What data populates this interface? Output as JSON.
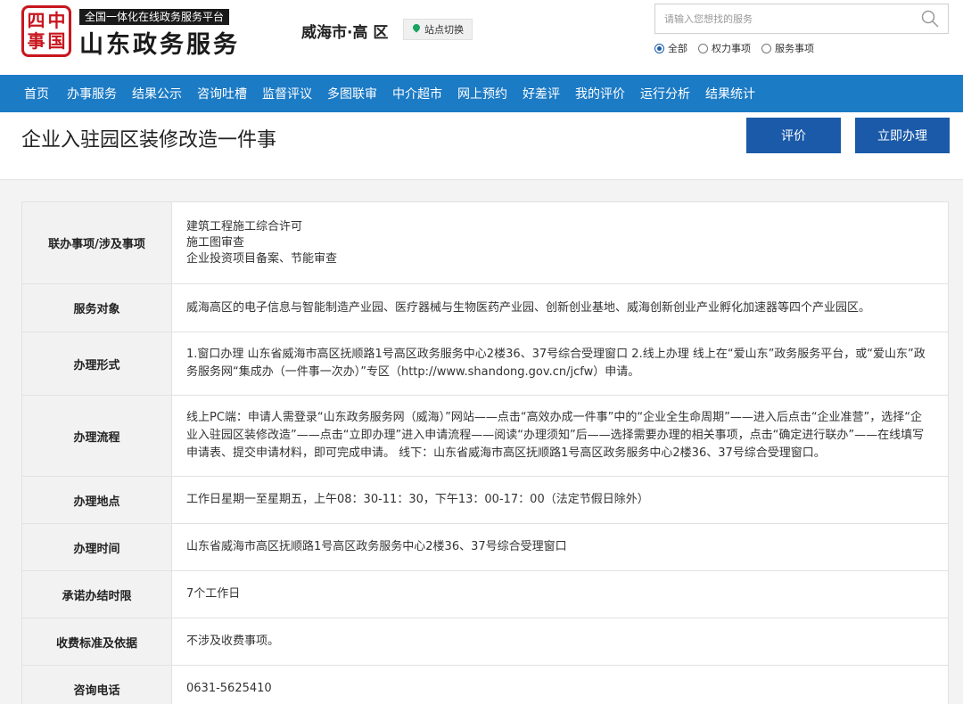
{
  "header": {
    "seal_chars": [
      "四",
      "中",
      "事",
      "国"
    ],
    "tagline": "全国一体化在线政务服务平台",
    "brand": "山东政务服务",
    "city": "威海市·高 区",
    "switch_label": "站点切换",
    "search_placeholder": "请输入您想找的服务",
    "filters": [
      {
        "label": "全部",
        "selected": true
      },
      {
        "label": "权力事项",
        "selected": false
      },
      {
        "label": "服务事项",
        "selected": false
      }
    ]
  },
  "nav": [
    "首页",
    "办事服务",
    "结果公示",
    "咨询吐槽",
    "监督评议",
    "多图联审",
    "中介超市",
    "网上预约",
    "好差评",
    "我的评价",
    "运行分析",
    "结果统计"
  ],
  "page": {
    "title": "企业入驻园区装修改造一件事",
    "rate_button": "评价",
    "apply_button": "立即办理"
  },
  "rows": [
    {
      "label": "联办事项/涉及事项",
      "lines": [
        "建筑工程施工综合许可",
        "施工图审查",
        "企业投资项目备案、节能审查"
      ]
    },
    {
      "label": "服务对象",
      "value": "威海高区的电子信息与智能制造产业园、医疗器械与生物医药产业园、创新创业基地、威海创新创业产业孵化加速器等四个产业园区。"
    },
    {
      "label": "办理形式",
      "value": "1.窗口办理 山东省威海市高区抚顺路1号高区政务服务中心2楼36、37号综合受理窗口 2.线上办理 线上在“爱山东”政务服务平台，或“爱山东”政务服务网“集成办（一件事一次办）”专区（http://www.shandong.gov.cn/jcfw）申请。"
    },
    {
      "label": "办理流程",
      "value": "线上PC端：申请人需登录“山东政务服务网（威海）”网站——点击“高效办成一件事”中的“企业全生命周期”——进入后点击“企业准营”，选择“企业入驻园区装修改造”——点击“立即办理”进入申请流程——阅读“办理须知”后——选择需要办理的相关事项，点击“确定进行联办”——在线填写申请表、提交申请材料，即可完成申请。 线下：山东省威海市高区抚顺路1号高区政务服务中心2楼36、37号综合受理窗口。"
    },
    {
      "label": "办理地点",
      "value": "工作日星期一至星期五，上午08：30-11：30，下午13：00-17：00（法定节假日除外）"
    },
    {
      "label": "办理时间",
      "value": "山东省威海市高区抚顺路1号高区政务服务中心2楼36、37号综合受理窗口"
    },
    {
      "label": "承诺办结时限",
      "value": "7个工作日"
    },
    {
      "label": "收费标准及依据",
      "value": "不涉及收费事项。"
    },
    {
      "label": "咨询电话",
      "value": "0631-5625410"
    }
  ]
}
